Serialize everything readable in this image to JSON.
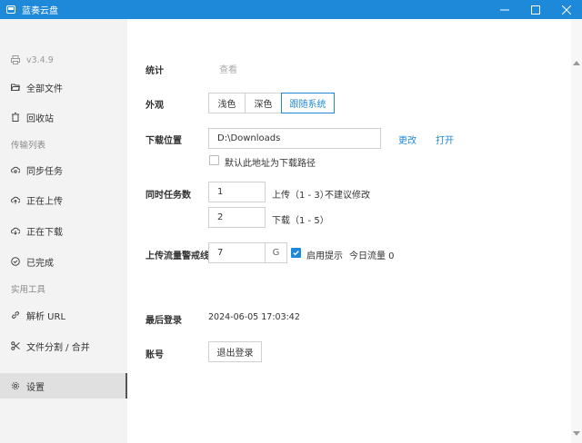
{
  "window": {
    "title": "蓝奏云盘"
  },
  "sidebar": {
    "version": "v3.4.9",
    "items": [
      {
        "label": "全部文件",
        "icon": "folder-open-icon"
      },
      {
        "label": "回收站",
        "icon": "trash-icon"
      },
      {
        "label": "同步任务",
        "icon": "cloud-sync-icon"
      },
      {
        "label": "正在上传",
        "icon": "cloud-upload-icon"
      },
      {
        "label": "正在下载",
        "icon": "cloud-download-icon"
      },
      {
        "label": "已完成",
        "icon": "check-circle-icon"
      },
      {
        "label": "解析 URL",
        "icon": "link-icon"
      },
      {
        "label": "文件分割 / 合并",
        "icon": "scissors-icon"
      },
      {
        "label": "设置",
        "icon": "gear-icon"
      }
    ],
    "section_transfer": "传输列表",
    "section_tools": "实用工具"
  },
  "settings": {
    "stats": {
      "label": "统计",
      "action": "查看"
    },
    "appearance": {
      "label": "外观",
      "options": [
        "浅色",
        "深色",
        "跟随系统"
      ],
      "selected": "跟随系统"
    },
    "download": {
      "label": "下载位置",
      "path": "D:\\Downloads",
      "change": "更改",
      "open": "打开",
      "default_checkbox": "默认此地址为下载路径",
      "default_checked": false
    },
    "concurrency": {
      "label": "同时任务数",
      "upload_value": "1",
      "upload_hint": "上传（1 - 3）",
      "upload_note": "不建议修改",
      "download_value": "2",
      "download_hint": "下载（1 - 5）"
    },
    "traffic": {
      "label": "上传流量警戒线",
      "value": "7",
      "unit": "G",
      "enable_label": "启用提示",
      "enabled": true,
      "today": "今日流量 0"
    },
    "last_login": {
      "label": "最后登录",
      "value": "2024-06-05 17:03:42"
    },
    "account": {
      "label": "账号",
      "logout": "退出登录"
    }
  },
  "colors": {
    "accent": "#1e88d9",
    "sidebar_bg": "#f3f3f3"
  }
}
